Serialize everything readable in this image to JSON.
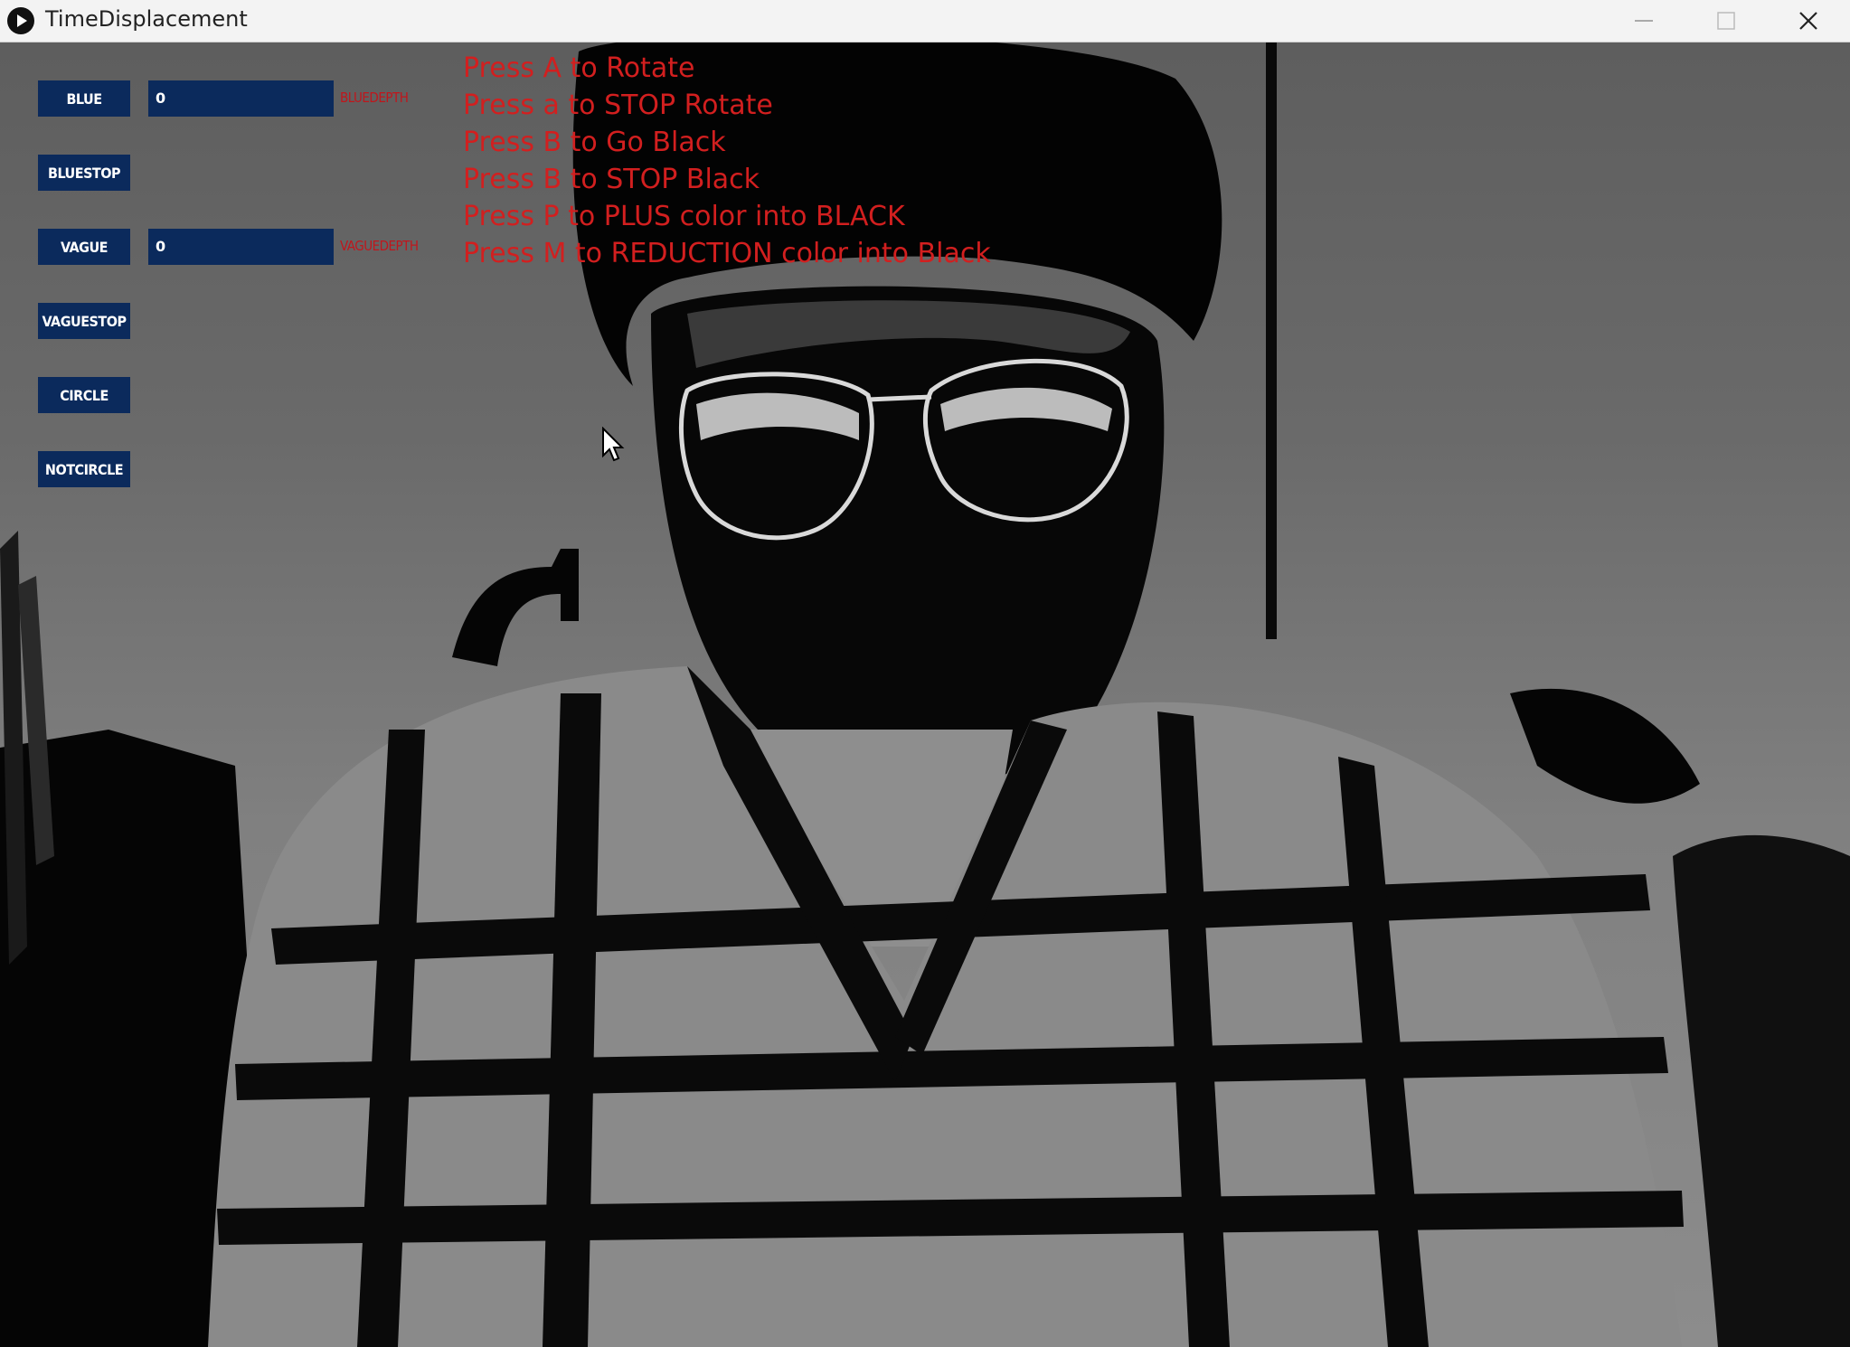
{
  "window": {
    "title": "TimeDisplacement"
  },
  "controls": {
    "buttons": [
      {
        "id": "blue",
        "label": "BLUE"
      },
      {
        "id": "bluestop",
        "label": "BLUESTOP"
      },
      {
        "id": "vague",
        "label": "VAGUE"
      },
      {
        "id": "vaguestop",
        "label": "VAGUESTOP"
      },
      {
        "id": "circle",
        "label": "CIRCLE"
      },
      {
        "id": "notcircle",
        "label": "NOTCIRCLE"
      }
    ],
    "sliders": [
      {
        "id": "bluedepth",
        "value": "0",
        "label": "BLUEDEPTH"
      },
      {
        "id": "vaguedepth",
        "value": "0",
        "label": "VAGUEDEPTH"
      }
    ]
  },
  "instructions": [
    "Press A to Rotate",
    "Press a to STOP Rotate",
    "Press B to Go Black",
    "Press B to STOP Black",
    "Press P to PLUS color into BLACK",
    "Press M to REDUCTION color into Black"
  ],
  "colors": {
    "control_bg": "#0b2a5c",
    "label_red": "#c0161c",
    "instruction_red": "#d21f1f"
  }
}
